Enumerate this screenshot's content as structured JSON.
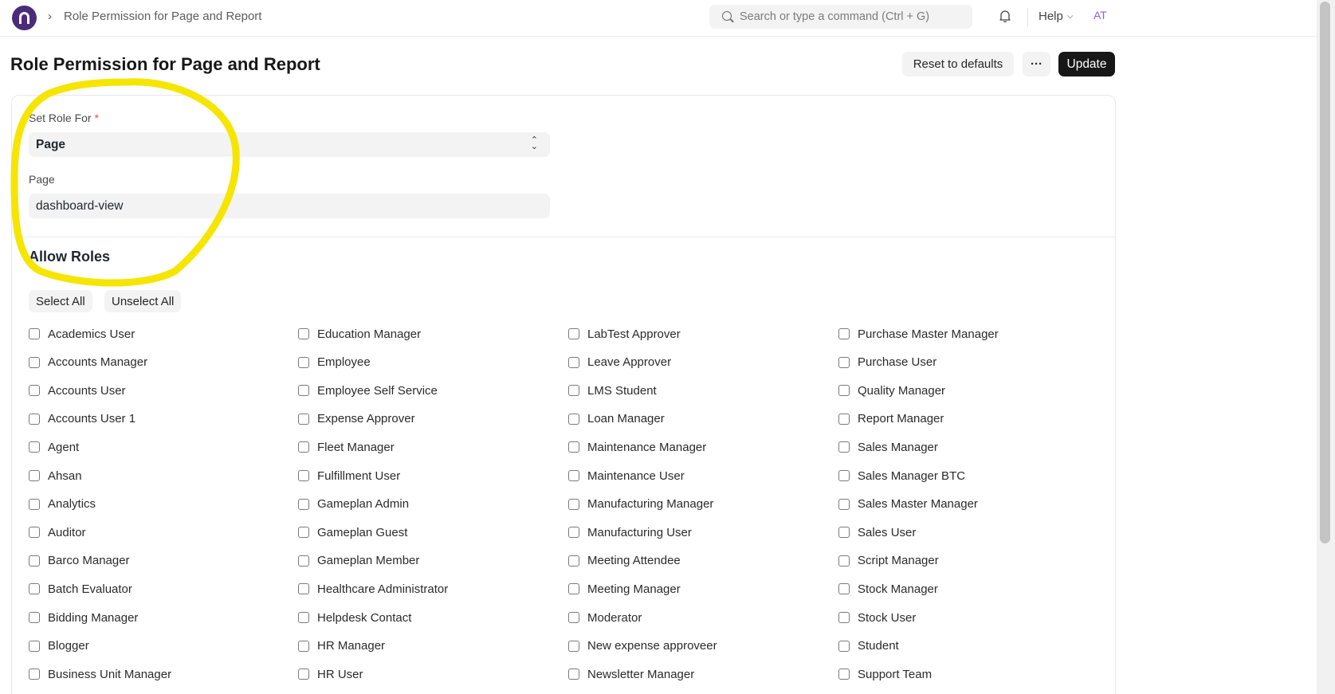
{
  "navbar": {
    "breadcrumb_sep": "›",
    "breadcrumb": "Role Permission for Page and Report",
    "search_placeholder": "Search or type a command (Ctrl + G)",
    "help_label": "Help",
    "help_chevron": "⌵",
    "avatar_initials": "AT"
  },
  "page": {
    "title": "Role Permission for Page and Report",
    "reset_label": "Reset to defaults",
    "more_label": "···",
    "update_label": "Update"
  },
  "form": {
    "set_role_for_label": "Set Role For",
    "required_mark": "*",
    "set_role_for_value": "Page",
    "page_label": "Page",
    "page_value": "dashboard-view"
  },
  "allow_roles": {
    "title": "Allow Roles",
    "select_all": "Select All",
    "unselect_all": "Unselect All",
    "columns": [
      [
        "Academics User",
        "Accounts Manager",
        "Accounts User",
        "Accounts User 1",
        "Agent",
        "Ahsan",
        "Analytics",
        "Auditor",
        "Barco Manager",
        "Batch Evaluator",
        "Bidding Manager",
        "Blogger",
        "Business Unit Manager"
      ],
      [
        "Education Manager",
        "Employee",
        "Employee Self Service",
        "Expense Approver",
        "Fleet Manager",
        "Fulfillment User",
        "Gameplan Admin",
        "Gameplan Guest",
        "Gameplan Member",
        "Healthcare Administrator",
        "Helpdesk Contact",
        "HR Manager",
        "HR User"
      ],
      [
        "LabTest Approver",
        "Leave Approver",
        "LMS Student",
        "Loan Manager",
        "Maintenance Manager",
        "Maintenance User",
        "Manufacturing Manager",
        "Manufacturing User",
        "Meeting Attendee",
        "Meeting Manager",
        "Moderator",
        "New expense approveer",
        "Newsletter Manager"
      ],
      [
        "Purchase Master Manager",
        "Purchase User",
        "Quality Manager",
        "Report Manager",
        "Sales Manager",
        "Sales Manager BTC",
        "Sales Master Manager",
        "Sales User",
        "Script Manager",
        "Stock Manager",
        "Stock User",
        "Student",
        "Support Team"
      ]
    ]
  },
  "colors": {
    "primary_button": "#171717",
    "annotation": "#f5e500",
    "avatar": "#8b5cf6"
  }
}
